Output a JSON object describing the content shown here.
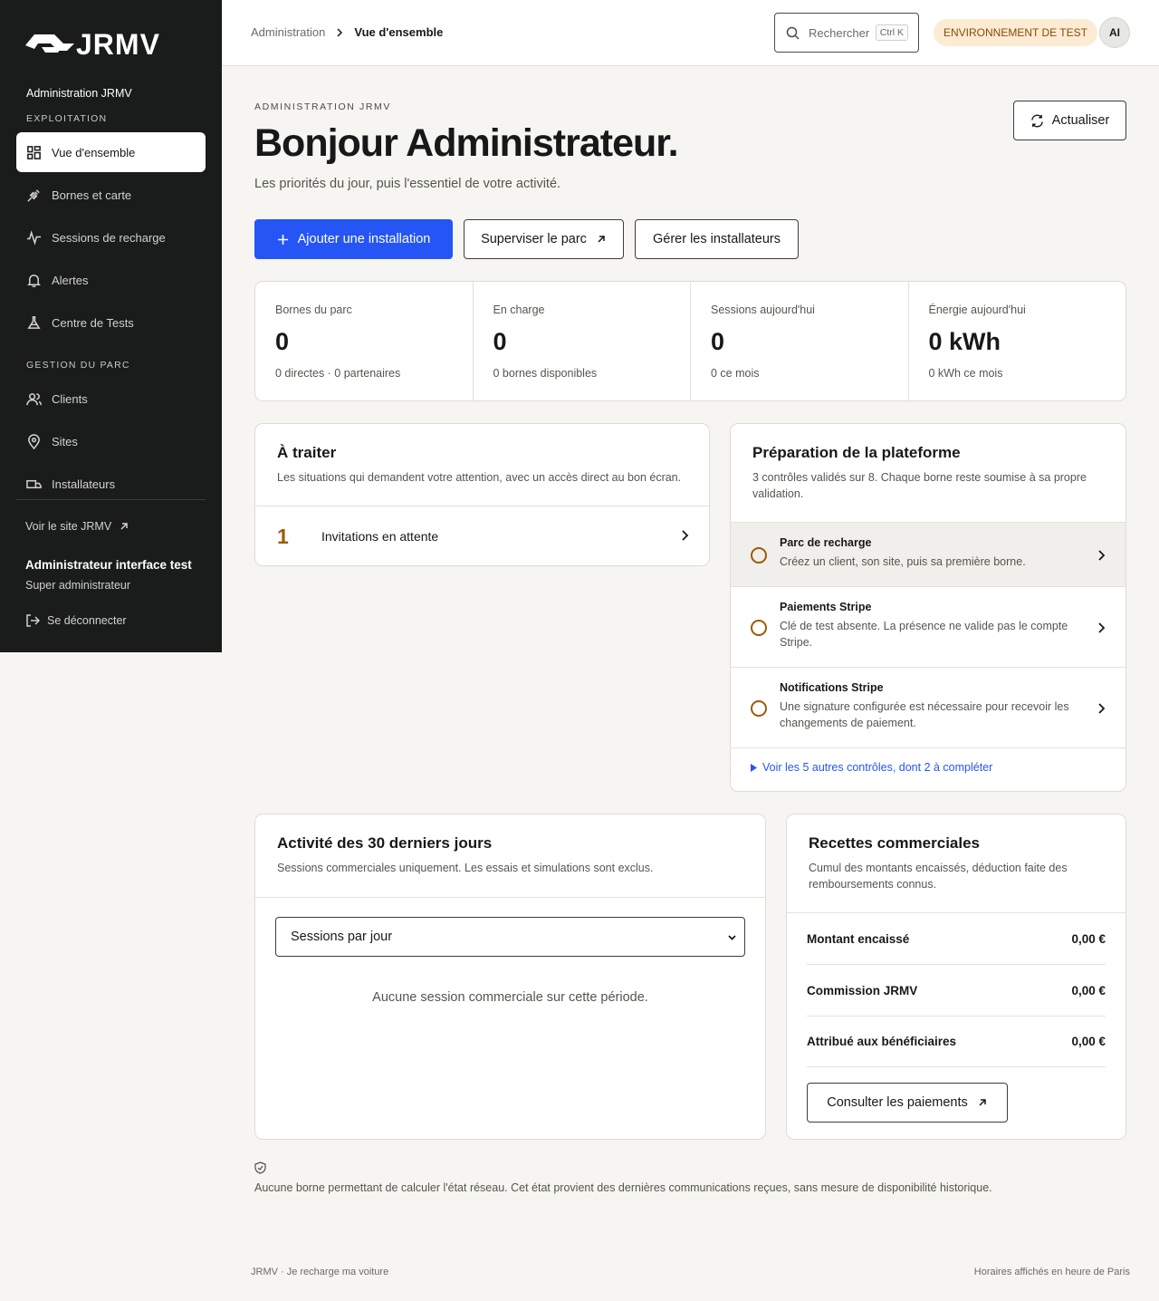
{
  "brand": {
    "logo_text": "JRMV"
  },
  "sidebar": {
    "title": "Administration JRMV",
    "sections": [
      {
        "label": "EXPLOITATION",
        "items": [
          {
            "label": "Vue d'ensemble",
            "icon": "dashboard-icon",
            "active": true
          },
          {
            "label": "Bornes et carte",
            "icon": "plug-icon"
          },
          {
            "label": "Sessions de recharge",
            "icon": "activity-icon"
          },
          {
            "label": "Alertes",
            "icon": "bell-icon"
          },
          {
            "label": "Centre de Tests",
            "icon": "flask-icon"
          }
        ]
      },
      {
        "label": "GESTION DU PARC",
        "items": [
          {
            "label": "Clients",
            "icon": "users-icon"
          },
          {
            "label": "Sites",
            "icon": "map-pin-icon"
          },
          {
            "label": "Installateurs",
            "icon": "truck-icon"
          }
        ]
      }
    ],
    "site_link": "Voir le site JRMV",
    "user_name": "Administrateur interface test",
    "user_role": "Super administrateur",
    "logout": "Se déconnecter"
  },
  "topbar": {
    "breadcrumb": [
      "Administration",
      "Vue d'ensemble"
    ],
    "search_placeholder": "Rechercher",
    "search_shortcut": "Ctrl K",
    "env_badge": "ENVIRONNEMENT DE TEST",
    "avatar_initials": "AI"
  },
  "header": {
    "eyebrow": "ADMINISTRATION JRMV",
    "title": "Bonjour Administrateur.",
    "lead": "Les priorités du jour, puis l'essentiel de votre activité.",
    "refresh": "Actualiser"
  },
  "actions": {
    "add_installation": "Ajouter une installation",
    "supervise": "Superviser le parc",
    "manage_installers": "Gérer les installateurs"
  },
  "stats": [
    {
      "label": "Bornes du parc",
      "value": "0",
      "sub": "0 directes · 0 partenaires"
    },
    {
      "label": "En charge",
      "value": "0",
      "sub": "0 bornes disponibles"
    },
    {
      "label": "Sessions aujourd'hui",
      "value": "0",
      "sub": "0 ce mois"
    },
    {
      "label": "Énergie aujourd'hui",
      "value": "0 kWh",
      "sub": "0 kWh ce mois"
    }
  ],
  "todo": {
    "title": "À traiter",
    "desc": "Les situations qui demandent votre attention, avec un accès direct au bon écran.",
    "items": [
      {
        "count": "1",
        "label": "Invitations en attente"
      }
    ]
  },
  "prep": {
    "title": "Préparation de la plateforme",
    "desc": "3 contrôles validés sur 8. Chaque borne reste soumise à sa propre validation.",
    "items": [
      {
        "title": "Parc de recharge",
        "desc": "Créez un client, son site, puis sa première borne."
      },
      {
        "title": "Paiements Stripe",
        "desc": "Clé de test absente. La présence ne valide pas le compte Stripe."
      },
      {
        "title": "Notifications Stripe",
        "desc": "Une signature configurée est nécessaire pour recevoir les changements de paiement."
      }
    ],
    "more": "Voir les 5 autres contrôles, dont 2 à compléter"
  },
  "activity": {
    "title": "Activité des 30 derniers jours",
    "desc": "Sessions commerciales uniquement. Les essais et simulations sont exclus.",
    "select_value": "Sessions par jour",
    "empty": "Aucune session commerciale sur cette période."
  },
  "revenue": {
    "title": "Recettes commerciales",
    "desc": "Cumul des montants encaissés, déduction faite des remboursements connus.",
    "rows": [
      {
        "label": "Montant encaissé",
        "value": "0,00 €"
      },
      {
        "label": "Commission JRMV",
        "value": "0,00 €"
      },
      {
        "label": "Attribué aux bénéficiaires",
        "value": "0,00 €"
      }
    ],
    "button": "Consulter les paiements"
  },
  "note": "Aucune borne permettant de calculer l'état réseau. Cet état provient des dernières communications reçues, sans mesure de disponibilité historique.",
  "footer": {
    "left": "JRMV · Je recharge ma voiture",
    "right": "Horaires affichés en heure de Paris"
  },
  "colors": {
    "primary": "#2555f5",
    "sidebar": "#1a1b1b",
    "accent": "#9c5a08",
    "env_badge_bg": "#fdebd4"
  }
}
